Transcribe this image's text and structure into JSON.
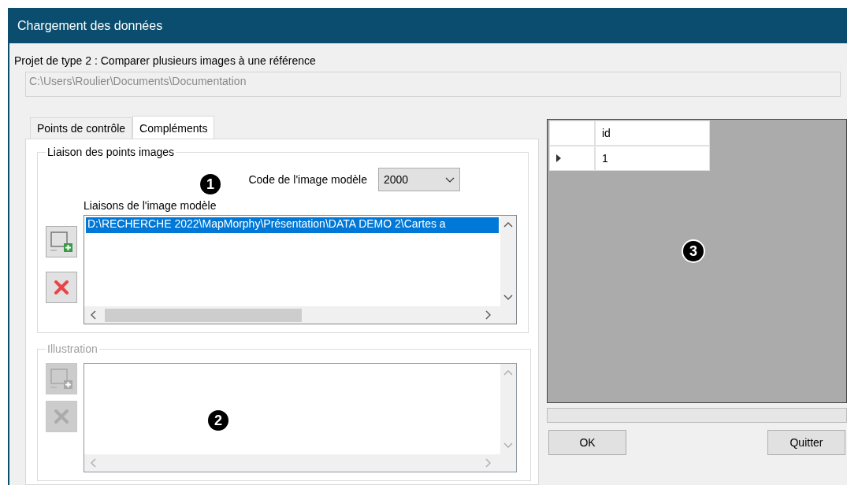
{
  "window": {
    "title": "Chargement des données"
  },
  "project_label": "Projet de type 2 : Comparer plusieurs images à une référence",
  "project_path": "C:\\Users\\Roulier\\Documents\\Documentation",
  "tabs": [
    {
      "label": "Points de contrôle",
      "selected": false
    },
    {
      "label": "Compléments",
      "selected": true
    }
  ],
  "groups": [
    {
      "title": "Liaison des points images",
      "disabled": false,
      "code_label": "Code de l'image modèle",
      "code_value": "2000",
      "list_label": "Liaisons de l'image modèle",
      "items": [
        {
          "text": "D:\\RECHERCHE 2022\\MapMorphy\\Présentation\\DATA DEMO 2\\Cartes a",
          "selected": true
        }
      ],
      "marker": "1"
    },
    {
      "title": "Illustration",
      "disabled": true,
      "marker": "2"
    }
  ],
  "grid": {
    "columns": [
      "id"
    ],
    "rows": [
      {
        "cells": [
          "1"
        ],
        "current": true
      }
    ],
    "marker": "3"
  },
  "buttons": [
    "OK",
    "Quitter"
  ]
}
